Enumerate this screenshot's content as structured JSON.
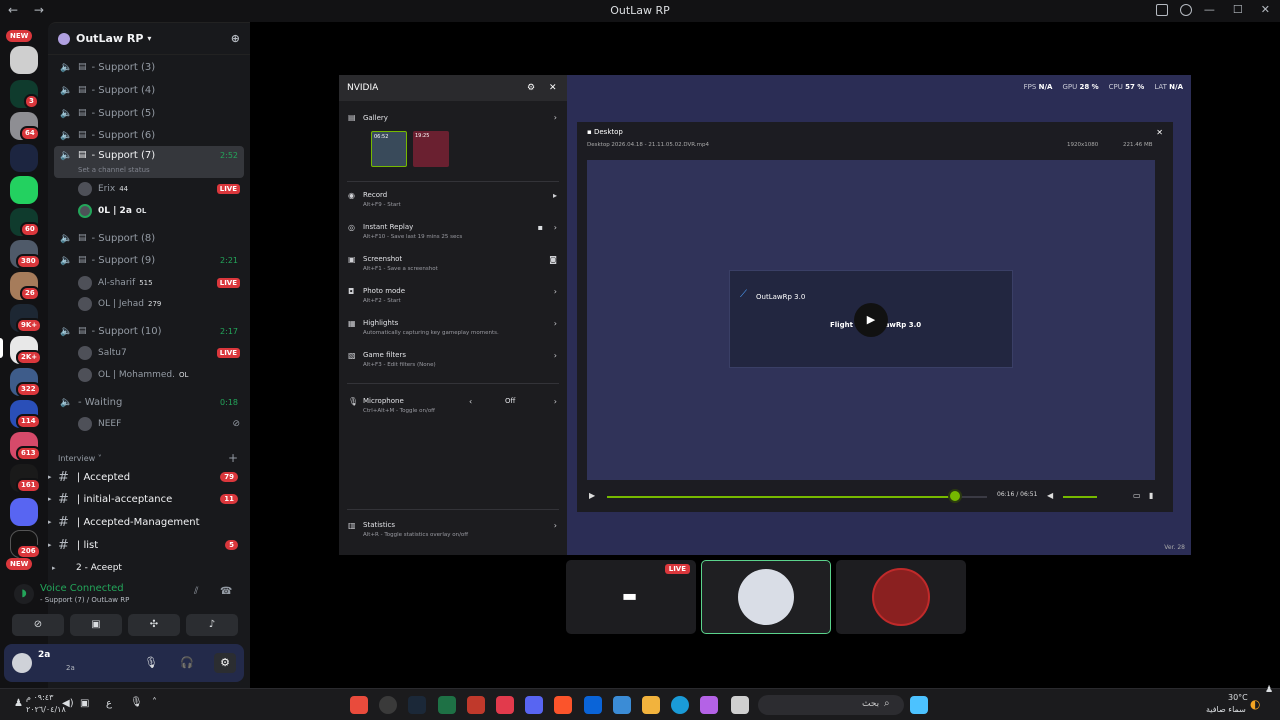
{
  "window": {
    "title": "OutLaw RP"
  },
  "rail": {
    "new_top": "NEW",
    "new_bottom": "NEW",
    "badges": [
      "3",
      "64",
      "60",
      "380",
      "26",
      "9K+",
      "2K+",
      "322",
      "114",
      "613",
      "161",
      "206"
    ]
  },
  "server": {
    "name": "OutLaw RP"
  },
  "channels": [
    {
      "name": "- Support  (3)"
    },
    {
      "name": "- Support  (4)"
    },
    {
      "name": "- Support  (5)"
    },
    {
      "name": "- Support  (6)"
    },
    {
      "name": "- Support  (7)",
      "time": "2:52",
      "status": "Set a channel status"
    },
    {
      "name": "- Support  (8)"
    },
    {
      "name": "- Support  (9)",
      "time": "2:21"
    },
    {
      "name": "- Support  (10)",
      "time": "2:17"
    },
    {
      "name": "- Waiting",
      "time": "0:18"
    }
  ],
  "voice_users": {
    "support7": [
      {
        "name": "Erix",
        "badge": "44",
        "live": "LIVE"
      },
      {
        "name": "0L | 2a",
        "badge": "OL"
      }
    ],
    "support9": [
      {
        "name": "Al-sharif",
        "badge": "515",
        "live": "LIVE"
      },
      {
        "name": "OL | Jehad",
        "badge": "279"
      }
    ],
    "support10": [
      {
        "name": "Saltu7",
        "live": "LIVE"
      },
      {
        "name": "OL | Mohammed.",
        "badge": "OL"
      }
    ],
    "waiting": [
      {
        "name": "NEEF"
      }
    ]
  },
  "category": {
    "name": "Interview"
  },
  "text_channels": [
    {
      "name": "| Accepted",
      "count": "79"
    },
    {
      "name": "| initial-acceptance",
      "count": "11"
    },
    {
      "name": "| Accepted-Management",
      "count": ""
    },
    {
      "name": "| list",
      "count": "5"
    }
  ],
  "thread": {
    "name": "2 - Aceept"
  },
  "voice_connected": {
    "title": "Voice Connected",
    "subtitle": "- Support  (7)   / OutLaw RP"
  },
  "user": {
    "name": "2a",
    "status": "2a"
  },
  "overlay_stats": {
    "fps_label": "FPS",
    "fps": "N/A",
    "gpu_label": "GPU",
    "gpu": "28 %",
    "cpu_label": "CPU",
    "cpu": "57 %",
    "lat_label": "LAT",
    "lat": "N/A"
  },
  "nvidia": {
    "title": "NVIDIA",
    "gallery": "Gallery",
    "thumb1": "06:52",
    "thumb2": "19:25",
    "items": [
      {
        "label": "Record",
        "sub": "Alt+F9 - Start"
      },
      {
        "label": "Instant Replay",
        "sub": "Alt+F10 - Save last 19 mins 25 secs"
      },
      {
        "label": "Screenshot",
        "sub": "Alt+F1 - Save a screenshot"
      },
      {
        "label": "Photo mode",
        "sub": "Alt+F2 - Start"
      },
      {
        "label": "Highlights",
        "sub": "Automatically capturing key gameplay moments."
      },
      {
        "label": "Game filters",
        "sub": "Alt+F3 - Edit filters (None)"
      }
    ],
    "microphone": {
      "label": "Microphone",
      "sub": "Ctrl+Alt+M - Toggle on/off",
      "value": "Off"
    },
    "statistics": {
      "label": "Statistics",
      "sub": "Alt+R - Toggle statistics overlay on/off"
    }
  },
  "player": {
    "title": "Desktop",
    "file": "Desktop 2026.04.18 - 21.11.05.02.DVR.mp4",
    "resolution": "1920x1080",
    "size": "221.46 MB",
    "popup_title": "OutLawRp 3.0",
    "popup_text": "Flight to OutLawRp 3.0",
    "time": "06:16 / 06:51",
    "progress": 0.915
  },
  "version": "Ver. 28",
  "tiles": {
    "live": "LIVE"
  },
  "taskbar": {
    "search": "بحث",
    "time": "٠٩:٤٣ م",
    "date": "٢٠٢٦/٠٤/١٨",
    "lang": "ع",
    "temp": "30°C",
    "weather": "سماء صافية"
  },
  "colors": {
    "accent_green": "#76b900",
    "live_red": "#da373c",
    "discord_green": "#23a55a"
  }
}
